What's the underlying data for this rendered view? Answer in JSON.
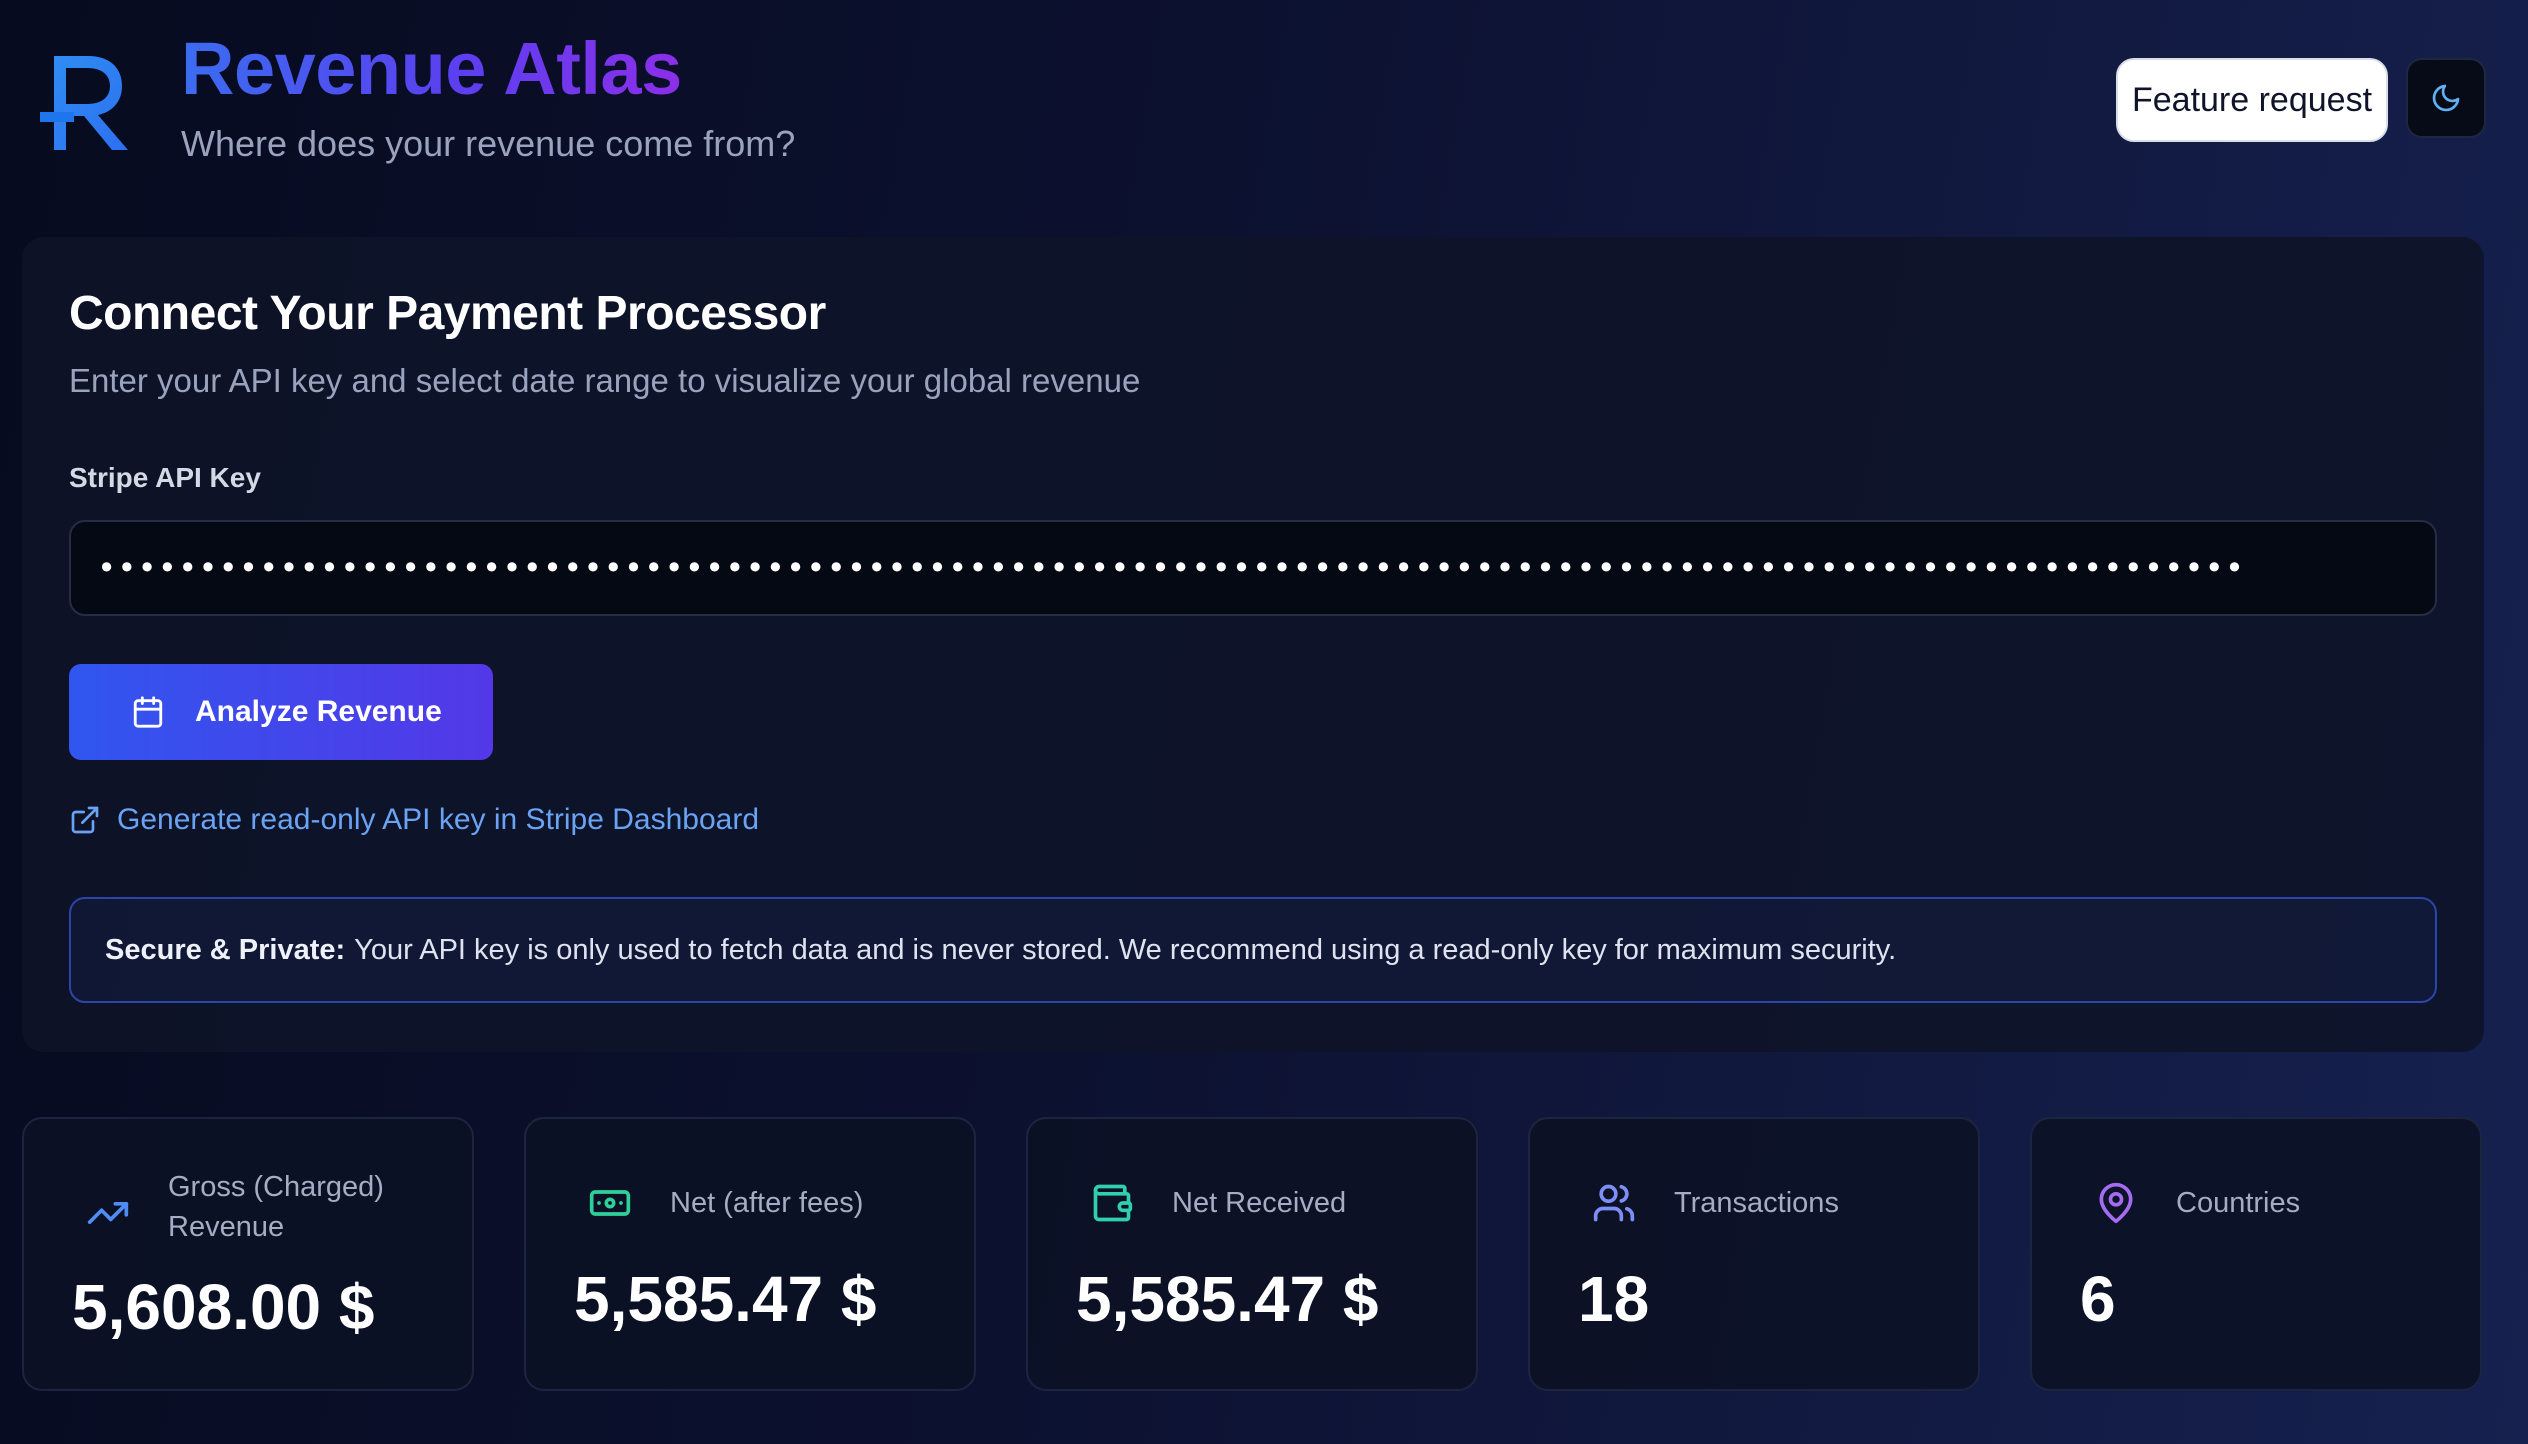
{
  "header": {
    "title": "Revenue Atlas",
    "subtitle": "Where does your revenue come from?",
    "feature_request_label": "Feature request",
    "logo_letter": "R"
  },
  "connect": {
    "title": "Connect Your Payment Processor",
    "subtitle": "Enter your API key and select date range to visualize your global revenue",
    "api_key_label": "Stripe API Key",
    "api_key_value": "••••••••••••••••••••••••••••••••••••••••••••••••••••••••••••••••••••••••••••••••••••••••••••••••••••••••••",
    "analyze_label": "Analyze Revenue",
    "generate_link_label": "Generate read-only API key in Stripe Dashboard",
    "notice_bold": "Secure & Private:",
    "notice_text": "Your API key is only used to fetch data and is never stored. We recommend using a read-only key for maximum security."
  },
  "stats": [
    {
      "label": "Gross (Charged) Revenue",
      "value": "5,608.00 $",
      "icon": "trending-up-icon",
      "color": "#4f8df5"
    },
    {
      "label": "Net (after fees)",
      "value": "5,585.47 $",
      "icon": "banknote-icon",
      "color": "#2fcf9a"
    },
    {
      "label": "Net Received",
      "value": "5,585.47 $",
      "icon": "wallet-icon",
      "color": "#2fcfb0"
    },
    {
      "label": "Transactions",
      "value": "18",
      "icon": "users-icon",
      "color": "#7d8ff6"
    },
    {
      "label": "Countries",
      "value": "6",
      "icon": "map-pin-icon",
      "color": "#a56cf2"
    }
  ],
  "colors": {
    "accent_blue": "#3056ef",
    "accent_violet": "#5338e8",
    "link": "#6aa3f4"
  }
}
